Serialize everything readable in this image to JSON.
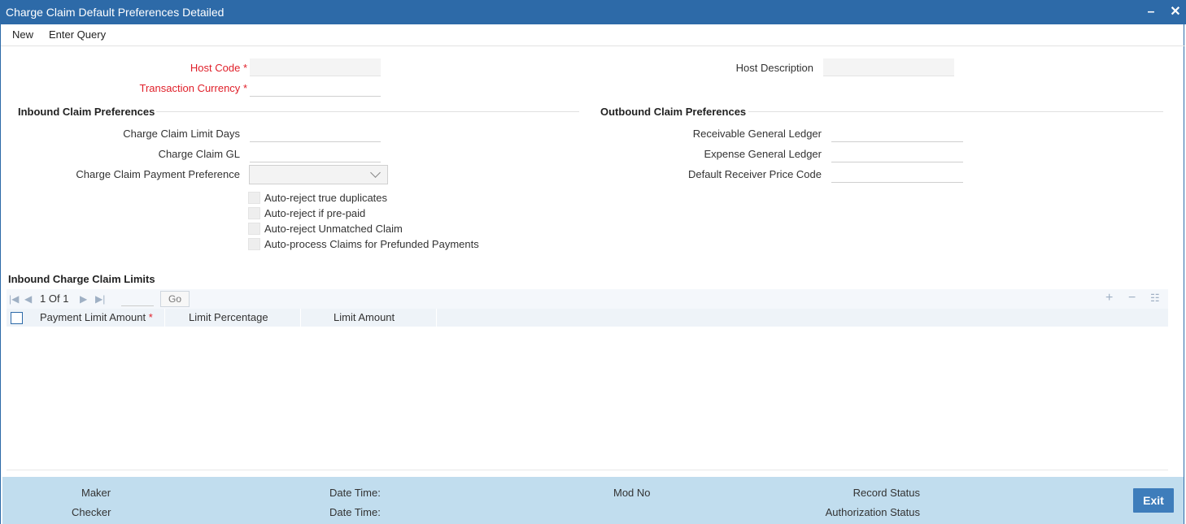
{
  "window": {
    "title": "Charge Claim Default Preferences Detailed",
    "minimize_glyph": "–",
    "close_glyph": "✕"
  },
  "menu": {
    "new_label": "New",
    "enter_query_label": "Enter Query"
  },
  "header_fields": {
    "host_code_label": "Host Code",
    "transaction_currency_label": "Transaction Currency",
    "host_description_label": "Host Description",
    "required_marker": "*"
  },
  "inbound": {
    "title": "Inbound Claim Preferences",
    "limit_days_label": "Charge Claim Limit Days",
    "gl_label": "Charge Claim GL",
    "payment_pref_label": "Charge Claim Payment Preference",
    "checkboxes": [
      "Auto-reject true duplicates",
      "Auto-reject if pre-paid",
      "Auto-reject Unmatched Claim",
      "Auto-process Claims for Prefunded Payments"
    ]
  },
  "outbound": {
    "title": "Outbound Claim Preferences",
    "receivable_gl_label": "Receivable General Ledger",
    "expense_gl_label": "Expense General Ledger",
    "receiver_price_code_label": "Default Receiver Price Code"
  },
  "limits_grid": {
    "title": "Inbound Charge Claim Limits",
    "pagination": {
      "current": "1",
      "of_label": "Of",
      "total": "1"
    },
    "go_label": "Go",
    "columns": [
      "Payment Limit Amount",
      "Limit Percentage",
      "Limit Amount"
    ],
    "required_marker": "*"
  },
  "footer": {
    "maker_label": "Maker",
    "checker_label": "Checker",
    "date_time_label": "Date Time:",
    "mod_no_label": "Mod No",
    "record_status_label": "Record Status",
    "authorization_status_label": "Authorization Status",
    "exit_label": "Exit"
  },
  "colors": {
    "titlebar": "#2d6aa8",
    "required": "#e0202a",
    "footer": "#c1ddee",
    "exit_button": "#3e7dbb"
  }
}
